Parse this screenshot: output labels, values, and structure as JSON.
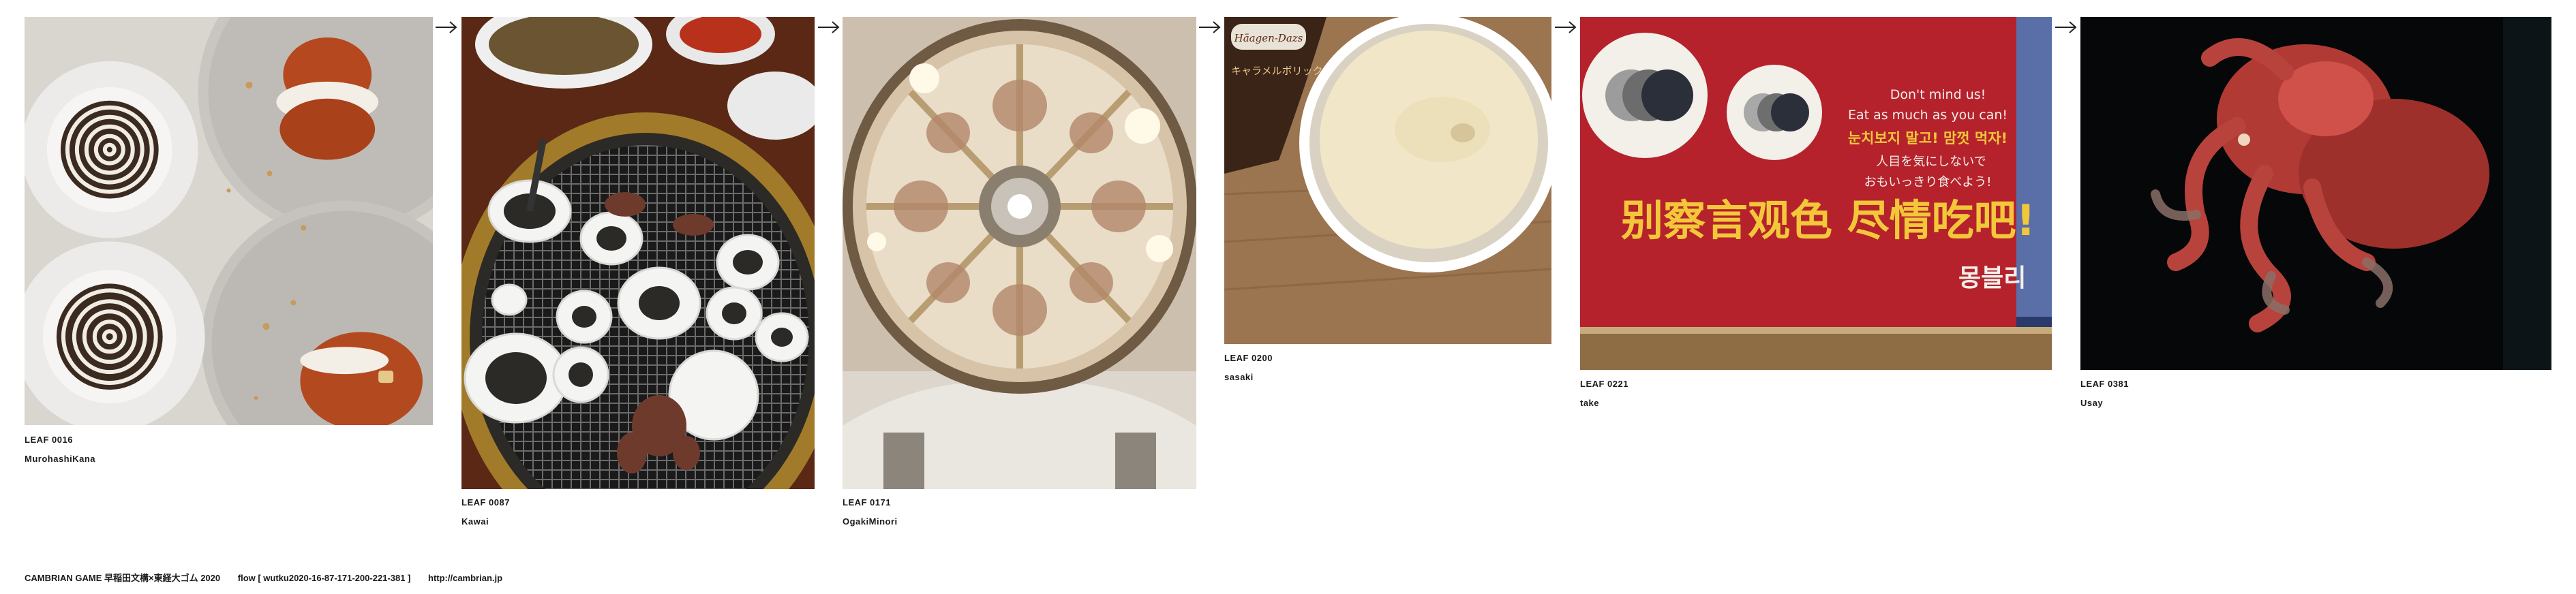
{
  "leaves": [
    {
      "leaf": "LEAF 0016",
      "author": "MurohashiKana",
      "subject": "latte-art-donuts-photo"
    },
    {
      "leaf": "LEAF 0087",
      "author": "Kawai",
      "subject": "korean-bbq-grill-photo"
    },
    {
      "leaf": "LEAF 0171",
      "author": "OgakiMinori",
      "subject": "church-dome-fresco-photo"
    },
    {
      "leaf": "LEAF 0200",
      "author": "sasaki",
      "subject": "ice-cream-cup-photo"
    },
    {
      "leaf": "LEAF 0221",
      "author": "take",
      "subject": "red-restaurant-sign-photo"
    },
    {
      "leaf": "LEAF 0381",
      "author": "Usay",
      "subject": "octopus-aquarium-photo"
    }
  ],
  "photo_text": {
    "icecream_brand": "Häagen-Dazs",
    "icecream_flavor": "キャラメルボリック",
    "sign_en_1": "Don't mind us!",
    "sign_en_2": "Eat as much as you can!",
    "sign_ko": "눈치보지 말고! 맘껏 먹자!",
    "sign_ja_1": "人目を気にしないで",
    "sign_ja_2": "おもいっきり食べよう!",
    "sign_cn": "别察言观色 尽情吃吧!",
    "sign_logo": "몽블리"
  },
  "footer": {
    "game": "CAMBRIAN GAME  早稲田文構×東経大ゴム 2020",
    "flow": "flow [ wutku2020-16-87-171-200-221-381 ]",
    "url": "http://cambrian.jp"
  },
  "colors": {
    "background": "#ffffff",
    "text": "#1a1a1a",
    "sign_red": "#b5222c",
    "sign_yellow": "#f2c83a"
  }
}
